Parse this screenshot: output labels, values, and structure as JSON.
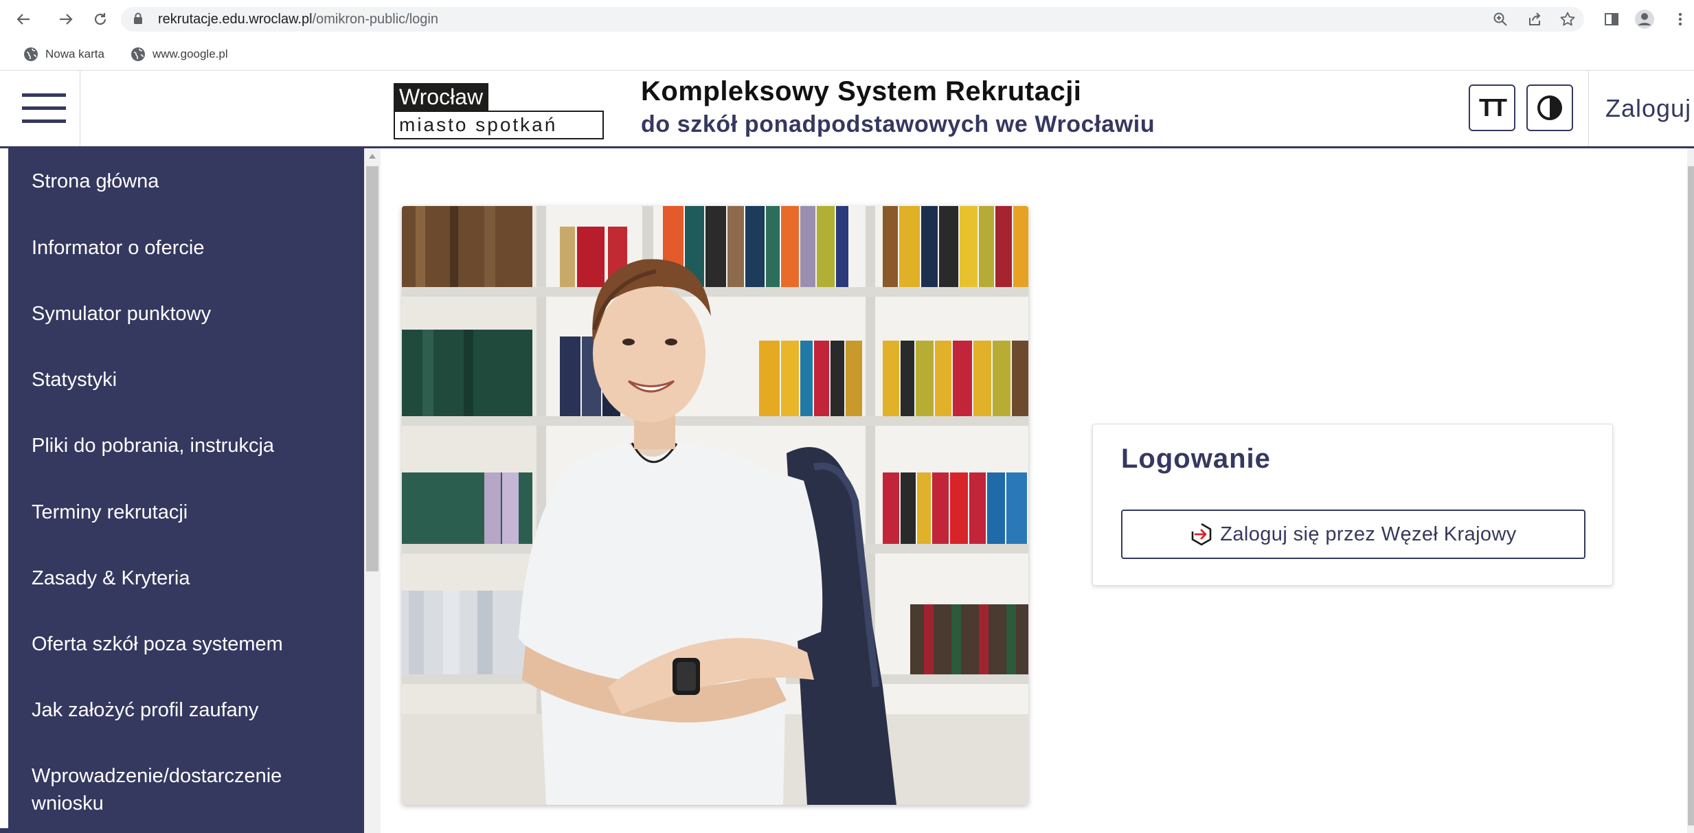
{
  "browser": {
    "url_host": "rekrutacje.edu.wroclaw.pl",
    "url_path": "/omikron-public/login",
    "icons": [
      "back-icon",
      "forward-icon",
      "reload-icon",
      "lock-icon",
      "zoom-icon",
      "share-icon",
      "star-icon",
      "side-panel-icon",
      "profile-icon",
      "menu-dots-icon"
    ],
    "bookmarks": [
      {
        "label": "Nowa karta",
        "icon": "globe-icon"
      },
      {
        "label": "www.google.pl",
        "icon": "globe-icon"
      }
    ]
  },
  "header": {
    "logo_top": "Wrocław",
    "logo_bottom": "miasto spotkań",
    "title": "Kompleksowy System Rekrutacji",
    "subtitle": "do szkół ponadpodstawowych we Wrocławiu",
    "font_size_glyph": "TT",
    "login_label": "Zaloguj"
  },
  "sidebar": {
    "items": [
      {
        "label": "Strona główna"
      },
      {
        "label": "Informator o ofercie"
      },
      {
        "label": "Symulator punktowy"
      },
      {
        "label": "Statystyki"
      },
      {
        "label": "Pliki do pobrania, instrukcja"
      },
      {
        "label": "Terminy rekrutacji"
      },
      {
        "label": "Zasady & Kryteria"
      },
      {
        "label": "Oferta szkół poza systemem"
      },
      {
        "label": "Jak założyć profil zaufany"
      },
      {
        "label_line1": "Wprowadzenie/dostarczenie",
        "label_line2": "wniosku"
      }
    ]
  },
  "login": {
    "title": "Logowanie",
    "button_label": "Zaloguj się przez Węzeł Krajowy",
    "button_icon": "wezel-krajowy-icon"
  },
  "colors": {
    "brand_navy": "#35385f",
    "accent_red": "#d8232a",
    "omnibox_bg": "#f1f3f4"
  }
}
